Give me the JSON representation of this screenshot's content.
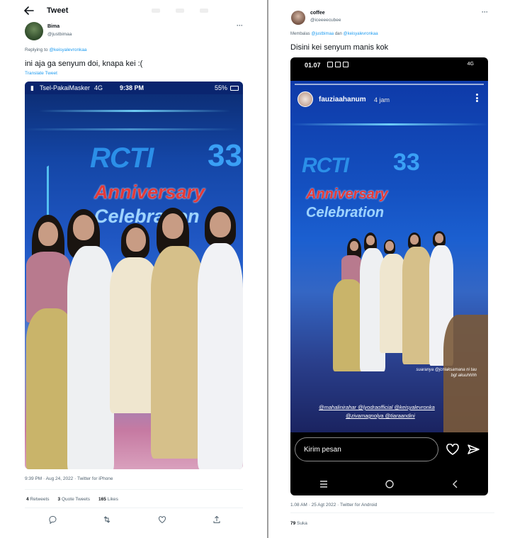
{
  "left": {
    "header_title": "Tweet",
    "author": {
      "name": "Bima",
      "handle": "@justbimaa"
    },
    "replying_to_prefix": "Replying to",
    "replying_to_handle": "@keisyalevronkaa",
    "text": "ini aja ga senyum doi, knapa kei :(",
    "translate_label": "Translate Tweet",
    "photo_status": {
      "carrier": "Tsel-PakaiMasker",
      "network": "4G",
      "time": "9:38 PM",
      "battery": "55%"
    },
    "photo_logo": {
      "brand": "RCTI",
      "number": "33",
      "line1": "Anniversary",
      "line2": "Celebration"
    },
    "timestamp": "9:39 PM · Aug 24, 2022 · Twitter for iPhone",
    "stats": {
      "retweets_count": "4",
      "retweets_label": "Retweets",
      "quotes_count": "3",
      "quotes_label": "Quote Tweets",
      "likes_count": "165",
      "likes_label": "Likes"
    },
    "actions": [
      "reply-icon",
      "retweet-icon",
      "like-icon",
      "share-icon"
    ]
  },
  "right": {
    "author": {
      "name": "coffee",
      "handle": "@iceeeecubee"
    },
    "reply_prefix": "Membalas",
    "reply_handle1": "@justbimaa",
    "reply_and": "dan",
    "reply_handle2": "@keisyalevronkaa",
    "text": "Disini kei senyum manis kok",
    "phone_status": {
      "time": "01.07",
      "right": "4G"
    },
    "story": {
      "user": "fauziaahanum",
      "time": "4 jam",
      "logo_brand": "RCTI",
      "logo_number": "33",
      "logo_line1": "Anniversary",
      "logo_line2": "Celebration",
      "note": "suaranya @jcnlaksamana ni tau bgt akuuhhhh",
      "mentions_line1": "@mahalinirahar @lyodraofficial @keisyalevronka",
      "mentions_line2": "@zivamagnolya @tiaraandini"
    },
    "dm_placeholder": "Kirim pesan",
    "timestamp": "1.08 AM · 25 Agt 2022 · Twitter for Android",
    "likes_count": "79",
    "likes_label": "Suka"
  }
}
